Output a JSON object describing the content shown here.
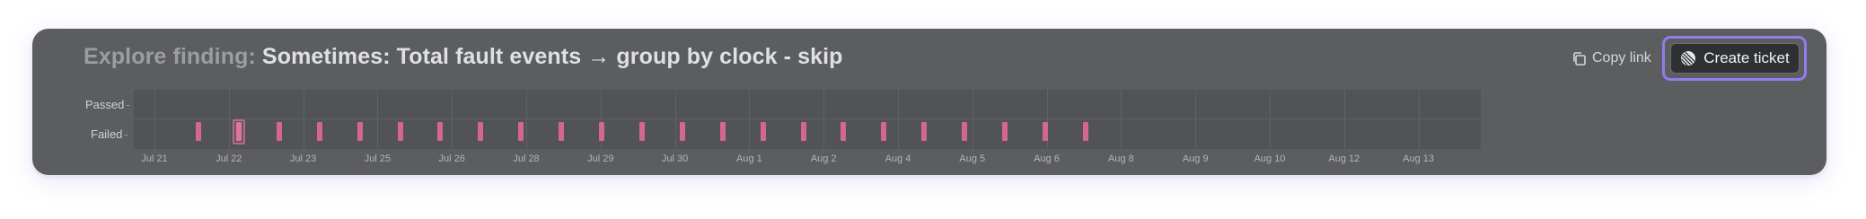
{
  "header": {
    "title_prefix": "Explore finding:",
    "title_main": "Sometimes: Total fault events → group by clock - skip"
  },
  "actions": {
    "copy_link_label": "Copy link",
    "create_ticket_label": "Create ticket"
  },
  "timeline": {
    "rows": [
      "Passed",
      "Failed"
    ],
    "dates": [
      "Jul 21",
      "Jul 22",
      "Jul 23",
      "Jul 25",
      "Jul 26",
      "Jul 28",
      "Jul 29",
      "Jul 30",
      "Aug 1",
      "Aug 2",
      "Aug 4",
      "Aug 5",
      "Aug 6",
      "Aug 8",
      "Aug 9",
      "Aug 10",
      "Aug 12",
      "Aug 13"
    ],
    "failed_event_count": 23,
    "selected_event": 1
  },
  "colors": {
    "panel": "#5c5d5f",
    "failed_bar": "#d4668f",
    "focus_ring": "#8f7cf0"
  }
}
